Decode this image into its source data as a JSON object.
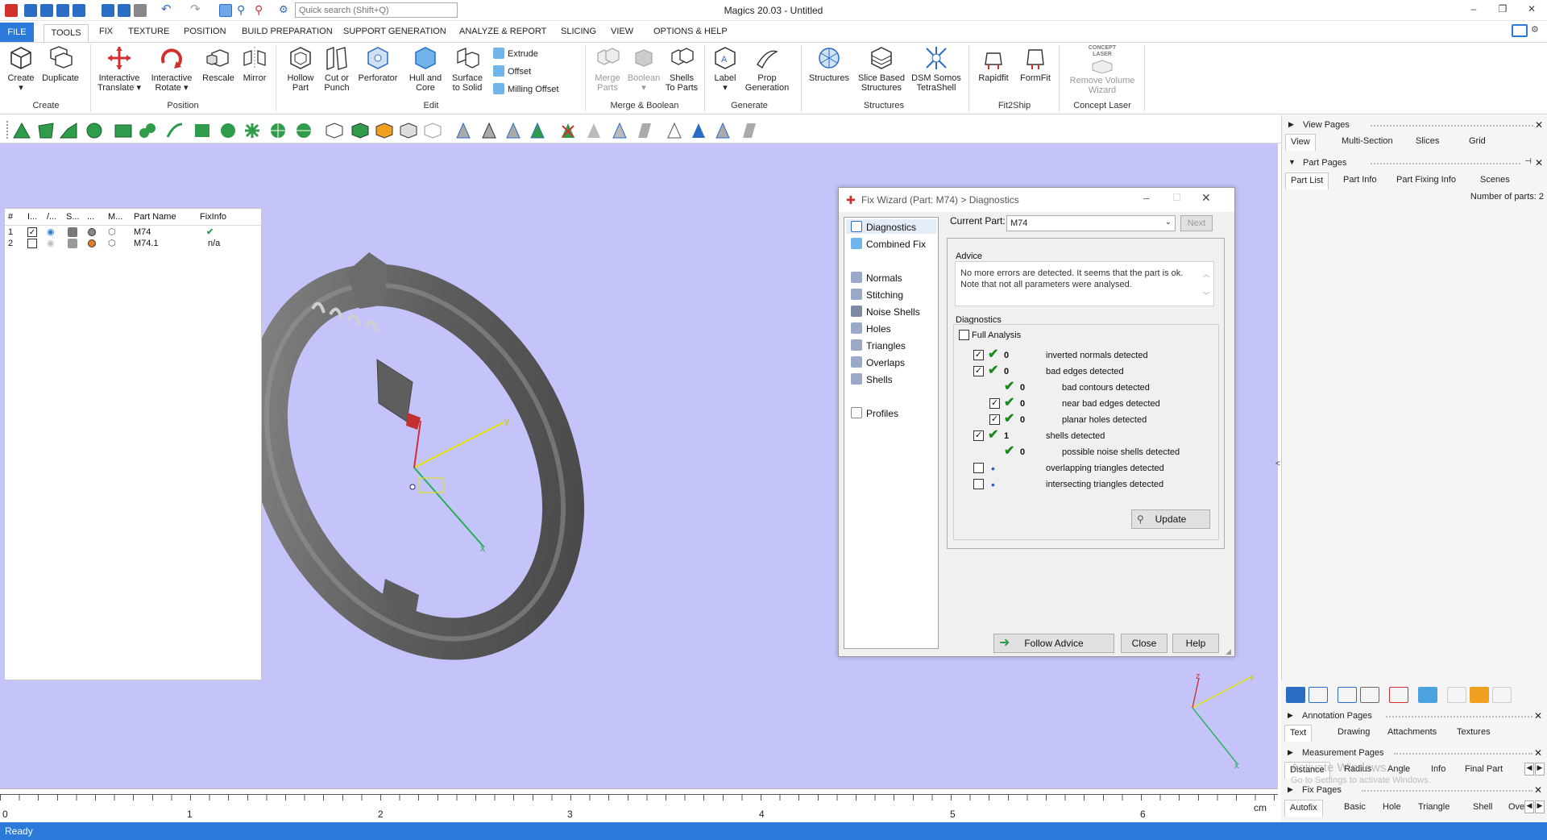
{
  "app": {
    "title": "Magics 20.03 - Untitled"
  },
  "search": {
    "placeholder": "Quick search (Shift+Q)"
  },
  "menu": {
    "file": "FILE",
    "items": [
      "TOOLS",
      "FIX",
      "TEXTURE",
      "POSITION",
      "BUILD PREPARATION",
      "SUPPORT GENERATION",
      "ANALYZE & REPORT",
      "SLICING",
      "VIEW",
      "OPTIONS & HELP"
    ]
  },
  "ribbon": {
    "create": {
      "label": "Create",
      "b1a": "Create",
      "b2a": "Duplicate"
    },
    "position": {
      "label": "Position",
      "b1a": "Interactive",
      "b1b": "Translate",
      "b2a": "Interactive",
      "b2b": "Rotate",
      "b3a": "Rescale",
      "b4a": "Mirror"
    },
    "edit": {
      "label": "Edit",
      "b1a": "Hollow",
      "b1b": "Part",
      "b2a": "Cut or",
      "b2b": "Punch",
      "b3a": "Perforator",
      "b4a": "Hull and",
      "b4b": "Core",
      "b5a": "Surface",
      "b5b": "to Solid",
      "s1": "Extrude",
      "s2": "Offset",
      "s3": "Milling Offset"
    },
    "merge": {
      "label": "Merge & Boolean",
      "b1a": "Merge",
      "b1b": "Parts",
      "b2a": "Boolean",
      "b3a": "Shells",
      "b3b": "To Parts"
    },
    "generate": {
      "label": "Generate",
      "b1a": "Label",
      "b2a": "Prop",
      "b2b": "Generation"
    },
    "structures": {
      "label": "Structures",
      "b1a": "Structures",
      "b2a": "Slice Based",
      "b2b": "Structures",
      "b3a": "DSM Somos",
      "b3b": "TetraShell"
    },
    "fit2ship": {
      "label": "Fit2Ship",
      "b1a": "Rapidfit",
      "b2a": "FormFit"
    },
    "concept": {
      "label": "Concept Laser",
      "logo_a": "CONCEPT",
      "logo_b": "LASER",
      "b1a": "Remove Volume",
      "b1b": "Wizard"
    }
  },
  "viewport": {
    "background": "#c4c4fb",
    "ruler": {
      "ticks": [
        "0",
        "1",
        "2",
        "3",
        "4",
        "5",
        "6"
      ],
      "unit": "cm"
    },
    "axis_labels": {
      "x": "x",
      "y": "y",
      "z": "z"
    }
  },
  "status": {
    "text": "Ready"
  },
  "dialog": {
    "title": "Fix Wizard (Part: M74) > Diagnostics",
    "nav": [
      "Diagnostics",
      "Combined Fix",
      "Normals",
      "Stitching",
      "Noise Shells",
      "Holes",
      "Triangles",
      "Overlaps",
      "Shells",
      "Profiles"
    ],
    "current_part_label": "Current Part:",
    "current_part": "M74",
    "next": "Next",
    "advice_title": "Advice",
    "advice_line1": "No more errors are detected. It seems that the part is ok.",
    "advice_line2": "Note that not all parameters were analysed.",
    "diagnostics_title": "Diagnostics",
    "full_analysis": "Full Analysis",
    "rows": [
      {
        "checked": true,
        "status": "ok",
        "count": "0",
        "label": "inverted normals detected"
      },
      {
        "checked": true,
        "status": "ok",
        "count": "0",
        "label": "bad edges detected"
      },
      {
        "checked": null,
        "status": "ok",
        "count": "0",
        "label": "bad contours detected"
      },
      {
        "checked": true,
        "status": "ok",
        "count": "0",
        "label": "near bad edges detected"
      },
      {
        "checked": true,
        "status": "ok",
        "count": "0",
        "label": "planar holes detected"
      },
      {
        "checked": true,
        "status": "ok",
        "count": "1",
        "label": "shells detected"
      },
      {
        "checked": null,
        "status": "ok",
        "count": "0",
        "label": "possible noise shells detected"
      },
      {
        "checked": false,
        "status": "none",
        "count": "",
        "label": "overlapping triangles detected"
      },
      {
        "checked": false,
        "status": "none",
        "count": "",
        "label": "intersecting triangles detected"
      }
    ],
    "update": "Update",
    "follow_advice": "Follow Advice",
    "close": "Close",
    "help": "Help"
  },
  "right_panel": {
    "view_pages": {
      "title": "View Pages",
      "tabs": [
        "View",
        "Multi-Section",
        "Slices",
        "Grid"
      ]
    },
    "part_pages": {
      "title": "Part Pages",
      "tabs": [
        "Part List",
        "Part Info",
        "Part Fixing Info",
        "Scenes"
      ],
      "count_label": "Number of parts: 2"
    },
    "table": {
      "headers": [
        "#",
        "I...",
        "/...",
        "S...",
        "...",
        "M...",
        "Part Name",
        "FixInfo"
      ],
      "rows": [
        {
          "num": "1",
          "checked": true,
          "color": "#888888",
          "name": "M74",
          "fixinfo": "✔"
        },
        {
          "num": "2",
          "checked": false,
          "color": "#e87a2a",
          "name": "M74.1",
          "fixinfo": "n/a"
        }
      ]
    },
    "annotation_pages": {
      "title": "Annotation Pages",
      "tabs": [
        "Text",
        "Drawing",
        "Attachments",
        "Textures"
      ]
    },
    "measurement_pages": {
      "title": "Measurement Pages",
      "tabs": [
        "Distance",
        "Radius",
        "Angle",
        "Info",
        "Final Part"
      ]
    },
    "fix_pages": {
      "title": "Fix Pages",
      "tabs": [
        "Autofix",
        "Basic",
        "Hole",
        "Triangle",
        "Shell",
        "Over"
      ]
    },
    "watermark_1": "Activate Windows",
    "watermark_2": "Go to Settings to activate Windows."
  }
}
